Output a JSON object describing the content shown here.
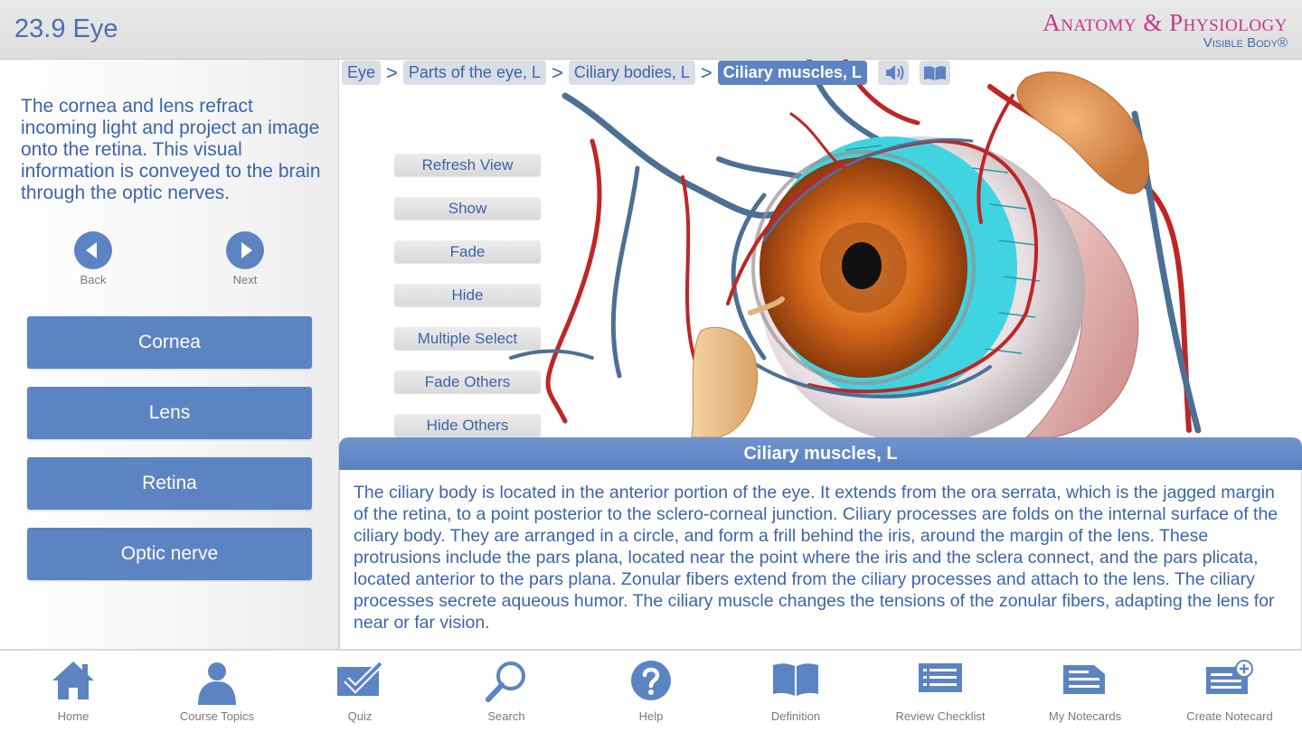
{
  "header": {
    "title": "23.9 Eye",
    "brand_name": "Anatomy & Physiology",
    "brand_sub": "Visible Body®"
  },
  "left": {
    "intro": "The cornea and lens refract incoming light and project an image onto the retina. This visual information is conveyed to the brain through the optic nerves.",
    "back_label": "Back",
    "next_label": "Next",
    "topics": [
      "Cornea",
      "Lens",
      "Retina",
      "Optic nerve"
    ]
  },
  "breadcrumb": {
    "items": [
      "Eye",
      "Parts of the eye, L",
      "Ciliary bodies, L",
      "Ciliary muscles, L"
    ],
    "separator": ">"
  },
  "controls": [
    "Refresh View",
    "Show",
    "Fade",
    "Hide",
    "Multiple Select",
    "Fade Others",
    "Hide Others"
  ],
  "info": {
    "title": "Ciliary muscles, L",
    "text": "The ciliary body is located in the anterior portion of the eye. It extends from the ora serrata, which is the jagged margin of the retina, to a point posterior to the sclero-corneal junction. Ciliary processes are folds on the internal surface of the ciliary body. They are arranged in a circle, and form a frill behind the iris, around the margin of the lens. These protrusions include the pars plana, located near the point where the iris and the sclera connect, and the pars plicata, located anterior to the pars plana. Zonular fibers extend from the ciliary processes and attach to the lens. The ciliary processes secrete aqueous humor. The ciliary muscle changes the tensions of the zonular fibers, adapting the lens for near or far vision."
  },
  "toolbar": {
    "items": [
      {
        "label": "Home",
        "icon": "home-icon"
      },
      {
        "label": "Course Topics",
        "icon": "person-icon"
      },
      {
        "label": "Quiz",
        "icon": "checkbox-icon"
      },
      {
        "label": "Search",
        "icon": "magnifier-icon"
      },
      {
        "label": "Help",
        "icon": "question-icon"
      },
      {
        "label": "Definition",
        "icon": "book-icon"
      },
      {
        "label": "Review Checklist",
        "icon": "checklist-icon"
      },
      {
        "label": "My Notecards",
        "icon": "notecards-icon"
      },
      {
        "label": "Create Notecard",
        "icon": "create-notecard-icon"
      }
    ]
  },
  "colors": {
    "accent": "#5c84c3",
    "text_blue": "#3b64ad",
    "brand_pink": "#c8368a"
  }
}
